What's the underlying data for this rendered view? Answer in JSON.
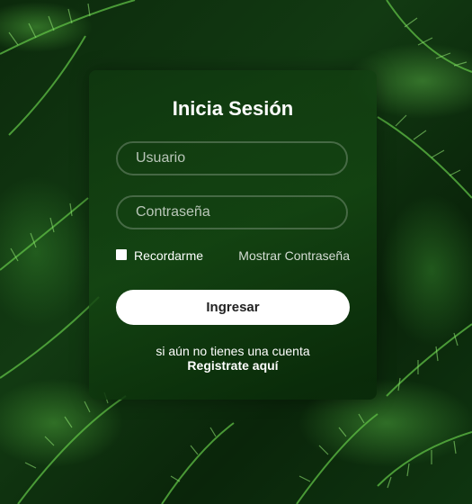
{
  "login": {
    "title": "Inicia Sesión",
    "username_placeholder": "Usuario",
    "password_placeholder": "Contraseña",
    "remember_label": "Recordarme",
    "show_password_label": "Mostrar Contraseña",
    "submit_label": "Ingresar",
    "no_account_text": "si aún no tienes una cuenta",
    "register_link": "Registrate aquí"
  },
  "background": {
    "description_icon": "fern-leaves-background"
  }
}
